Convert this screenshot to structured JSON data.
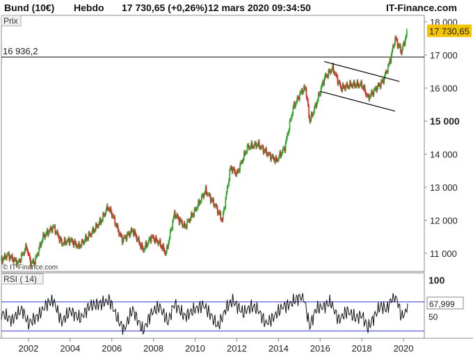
{
  "header": {
    "instrument": "Bund (10€)",
    "period": "Hebdo",
    "quote": "17 730,65 (+0,26%)",
    "datetime": "12 mars 2020 09:34:50",
    "site": "IT-Finance.com"
  },
  "colors": {
    "up": "#2ca02c",
    "down": "#d62728",
    "price_badge": "#f5c400",
    "rsi_bands": "#3b3bd6"
  },
  "chart_data": [
    {
      "type": "candlestick",
      "panel_label": "Prix",
      "watermark": "© IT-Finance.com",
      "x_ticks": [
        "2002",
        "2004",
        "2006",
        "2008",
        "2010",
        "2012",
        "2014",
        "2016",
        "2018",
        "2020"
      ],
      "y_ticks": [
        "11 000",
        "12 000",
        "13 000",
        "14 000",
        "15 000",
        "16 000",
        "17 000",
        "18 000"
      ],
      "y_tick_values": [
        11000,
        12000,
        13000,
        14000,
        15000,
        16000,
        17000,
        18000
      ],
      "highlight_tick": "15 000",
      "ylim": [
        10450,
        18200
      ],
      "xlim": [
        2000.7,
        2021.0
      ],
      "last_price_label": "17 730,65",
      "last_price": 17730.65,
      "horizontal_line": {
        "label": "16 936,2",
        "value": 16936.2
      },
      "trend_channel": {
        "upper": [
          [
            2016.2,
            16800
          ],
          [
            2019.8,
            16200
          ]
        ],
        "lower": [
          [
            2016.0,
            15900
          ],
          [
            2019.6,
            15300
          ]
        ]
      },
      "series": [
        {
          "x": 2000.7,
          "y": 10800
        },
        {
          "x": 2001.0,
          "y": 10950
        },
        {
          "x": 2001.5,
          "y": 10700
        },
        {
          "x": 2001.9,
          "y": 11200
        },
        {
          "x": 2002.1,
          "y": 10700
        },
        {
          "x": 2002.3,
          "y": 10750
        },
        {
          "x": 2002.7,
          "y": 11500
        },
        {
          "x": 2003.2,
          "y": 11800
        },
        {
          "x": 2003.6,
          "y": 11300
        },
        {
          "x": 2004.0,
          "y": 11400
        },
        {
          "x": 2004.4,
          "y": 11200
        },
        {
          "x": 2005.0,
          "y": 11600
        },
        {
          "x": 2005.5,
          "y": 12000
        },
        {
          "x": 2005.8,
          "y": 12400
        },
        {
          "x": 2006.0,
          "y": 12200
        },
        {
          "x": 2006.3,
          "y": 11700
        },
        {
          "x": 2006.5,
          "y": 11400
        },
        {
          "x": 2007.0,
          "y": 11700
        },
        {
          "x": 2007.5,
          "y": 11100
        },
        {
          "x": 2007.9,
          "y": 11500
        },
        {
          "x": 2008.3,
          "y": 11300
        },
        {
          "x": 2008.6,
          "y": 11000
        },
        {
          "x": 2009.0,
          "y": 12200
        },
        {
          "x": 2009.5,
          "y": 11800
        },
        {
          "x": 2010.0,
          "y": 12300
        },
        {
          "x": 2010.5,
          "y": 12900
        },
        {
          "x": 2010.7,
          "y": 12700
        },
        {
          "x": 2011.0,
          "y": 12400
        },
        {
          "x": 2011.3,
          "y": 12000
        },
        {
          "x": 2011.7,
          "y": 13600
        },
        {
          "x": 2012.0,
          "y": 13400
        },
        {
          "x": 2012.5,
          "y": 14200
        },
        {
          "x": 2013.0,
          "y": 14300
        },
        {
          "x": 2013.5,
          "y": 14000
        },
        {
          "x": 2013.9,
          "y": 13800
        },
        {
          "x": 2014.3,
          "y": 14200
        },
        {
          "x": 2014.7,
          "y": 15400
        },
        {
          "x": 2015.1,
          "y": 15900
        },
        {
          "x": 2015.3,
          "y": 16000
        },
        {
          "x": 2015.5,
          "y": 15000
        },
        {
          "x": 2015.8,
          "y": 15500
        },
        {
          "x": 2016.2,
          "y": 16300
        },
        {
          "x": 2016.6,
          "y": 16600
        },
        {
          "x": 2017.0,
          "y": 16000
        },
        {
          "x": 2017.5,
          "y": 16100
        },
        {
          "x": 2018.0,
          "y": 16100
        },
        {
          "x": 2018.3,
          "y": 15700
        },
        {
          "x": 2018.7,
          "y": 16000
        },
        {
          "x": 2019.0,
          "y": 16200
        },
        {
          "x": 2019.3,
          "y": 16700
        },
        {
          "x": 2019.6,
          "y": 17500
        },
        {
          "x": 2019.9,
          "y": 17100
        },
        {
          "x": 2020.2,
          "y": 17730.65
        }
      ]
    },
    {
      "type": "line",
      "label": "RSI ( 14)",
      "value_label": "67,999",
      "value": 67.999,
      "y_ticks": [
        "100",
        "50"
      ],
      "y_tick_values": [
        100,
        50
      ],
      "ylim": [
        20,
        110
      ],
      "bands": [
        70,
        30
      ],
      "series": [
        {
          "x": 2000.7,
          "y": 55
        },
        {
          "x": 2001.2,
          "y": 45
        },
        {
          "x": 2001.7,
          "y": 60
        },
        {
          "x": 2002.0,
          "y": 40
        },
        {
          "x": 2002.5,
          "y": 52
        },
        {
          "x": 2002.9,
          "y": 68
        },
        {
          "x": 2003.2,
          "y": 72
        },
        {
          "x": 2003.6,
          "y": 42
        },
        {
          "x": 2004.0,
          "y": 58
        },
        {
          "x": 2004.5,
          "y": 47
        },
        {
          "x": 2004.9,
          "y": 64
        },
        {
          "x": 2005.5,
          "y": 68
        },
        {
          "x": 2005.9,
          "y": 73
        },
        {
          "x": 2006.3,
          "y": 45
        },
        {
          "x": 2006.6,
          "y": 32
        },
        {
          "x": 2007.0,
          "y": 60
        },
        {
          "x": 2007.5,
          "y": 30
        },
        {
          "x": 2007.9,
          "y": 55
        },
        {
          "x": 2008.3,
          "y": 64
        },
        {
          "x": 2008.7,
          "y": 42
        },
        {
          "x": 2009.0,
          "y": 68
        },
        {
          "x": 2009.5,
          "y": 50
        },
        {
          "x": 2010.0,
          "y": 60
        },
        {
          "x": 2010.4,
          "y": 66
        },
        {
          "x": 2010.8,
          "y": 50
        },
        {
          "x": 2011.1,
          "y": 36
        },
        {
          "x": 2011.5,
          "y": 62
        },
        {
          "x": 2011.8,
          "y": 72
        },
        {
          "x": 2012.3,
          "y": 55
        },
        {
          "x": 2012.7,
          "y": 64
        },
        {
          "x": 2013.0,
          "y": 60
        },
        {
          "x": 2013.4,
          "y": 40
        },
        {
          "x": 2013.8,
          "y": 50
        },
        {
          "x": 2014.2,
          "y": 63
        },
        {
          "x": 2014.6,
          "y": 68
        },
        {
          "x": 2014.9,
          "y": 75
        },
        {
          "x": 2015.2,
          "y": 78
        },
        {
          "x": 2015.5,
          "y": 36
        },
        {
          "x": 2015.8,
          "y": 60
        },
        {
          "x": 2016.2,
          "y": 64
        },
        {
          "x": 2016.5,
          "y": 70
        },
        {
          "x": 2016.9,
          "y": 45
        },
        {
          "x": 2017.3,
          "y": 58
        },
        {
          "x": 2017.7,
          "y": 48
        },
        {
          "x": 2018.0,
          "y": 52
        },
        {
          "x": 2018.3,
          "y": 34
        },
        {
          "x": 2018.6,
          "y": 50
        },
        {
          "x": 2018.9,
          "y": 65
        },
        {
          "x": 2019.2,
          "y": 60
        },
        {
          "x": 2019.5,
          "y": 78
        },
        {
          "x": 2019.7,
          "y": 73
        },
        {
          "x": 2019.9,
          "y": 50
        },
        {
          "x": 2020.1,
          "y": 55
        },
        {
          "x": 2020.2,
          "y": 68
        }
      ]
    }
  ]
}
